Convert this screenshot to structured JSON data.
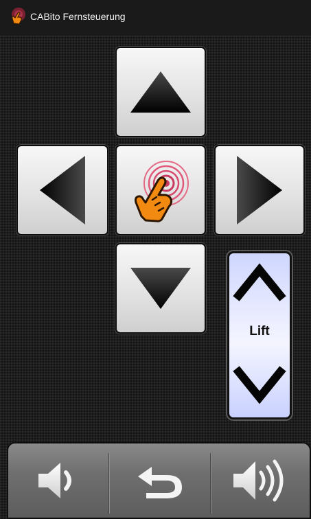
{
  "app": {
    "title": "CABito Fernsteuerung",
    "icon": "hand-pointer-icon"
  },
  "controls": {
    "up": "up-arrow-icon",
    "down": "down-arrow-icon",
    "left": "left-arrow-icon",
    "right": "right-arrow-icon",
    "center": "touch-hand-icon"
  },
  "lift": {
    "label": "Lift",
    "up_icon": "chevron-up-icon",
    "down_icon": "chevron-down-icon"
  },
  "bottom_bar": {
    "volume_down": "volume-down-icon",
    "back": "back-icon",
    "volume_up": "volume-up-icon"
  },
  "colors": {
    "background": "#1d1d1d",
    "button_face": "#e3e3e3",
    "lift_face": "#dde2ff",
    "hand_orange": "#f28a12",
    "target_red": "#d63a5a"
  }
}
